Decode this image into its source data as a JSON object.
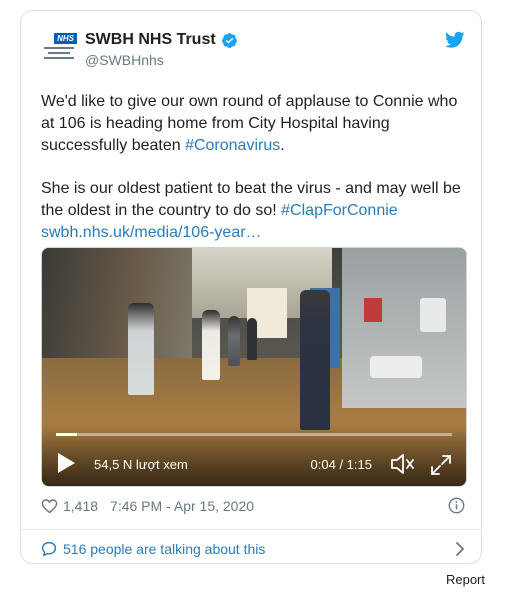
{
  "author": {
    "name": "SWBH NHS Trust",
    "handle": "@SWBHnhs",
    "logo_badge": "NHS",
    "verified": true
  },
  "tweet": {
    "para1_prefix": "We'd like to give our own round of applause to Connie who at 106 is heading home from City Hospital having successfully beaten ",
    "para1_hashtag": "#Coronavirus",
    "para1_suffix": ".",
    "para2_prefix": "She is our oldest patient to beat the virus - and may well be the oldest in the country to do so! ",
    "para2_hashtag": "#ClapForConnie",
    "link": "swbh.nhs.uk/media/106-year…"
  },
  "video": {
    "views_label": "54,5 N lượt xem",
    "time_label": "0:04 / 1:15",
    "progress": 0.053
  },
  "meta": {
    "likes": "1,418",
    "timestamp": "7:46 PM - Apr 15, 2020"
  },
  "talking": {
    "label": "516 people are talking about this"
  },
  "footer": {
    "report": "Report"
  },
  "colors": {
    "link": "#2b7bb9",
    "twitter_blue": "#1da1f2",
    "nhs_blue": "#005eb8",
    "muted": "#697882"
  },
  "icons": [
    "verified-badge-icon",
    "twitter-bird-icon",
    "play-icon",
    "volume-icon",
    "fullscreen-icon",
    "heart-icon",
    "info-icon",
    "comment-bubble-icon",
    "chevron-right-icon"
  ]
}
